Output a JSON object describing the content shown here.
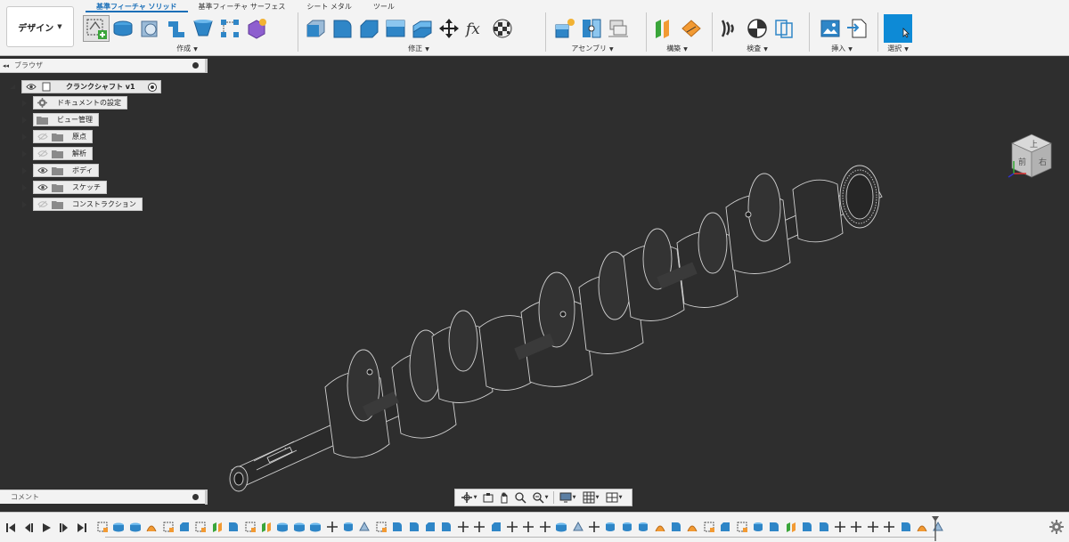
{
  "workspace": {
    "label": "デザイン"
  },
  "tabs": [
    {
      "label": "基準フィーチャ ソリッド",
      "active": true
    },
    {
      "label": "基準フィーチャ サーフェス",
      "active": false
    },
    {
      "label": "シート メタル",
      "active": false
    },
    {
      "label": "ツール",
      "active": false
    }
  ],
  "groups": {
    "create": "作成",
    "modify": "修正",
    "assemble": "アセンブリ",
    "construct": "構築",
    "inspect": "検査",
    "insert": "挿入",
    "select": "選択"
  },
  "browser": {
    "title": "ブラウザ",
    "root": "クランクシャフト v1",
    "items": [
      {
        "label": "ドキュメントの設定",
        "icon": "gear-icon",
        "visible": null
      },
      {
        "label": "ビュー管理",
        "icon": "folder-icon",
        "visible": null
      },
      {
        "label": "原点",
        "icon": "folder-icon",
        "visible": false
      },
      {
        "label": "解析",
        "icon": "folder-icon",
        "visible": false
      },
      {
        "label": "ボディ",
        "icon": "folder-icon",
        "visible": true
      },
      {
        "label": "スケッチ",
        "icon": "folder-icon",
        "visible": true
      },
      {
        "label": "コンストラクション",
        "icon": "folder-icon",
        "visible": false
      }
    ]
  },
  "viewcube": {
    "top_label": "上",
    "front_label": "前",
    "right_label": "右"
  },
  "comments": {
    "label": "コメント"
  },
  "colors": {
    "accent": "#1a6fb8",
    "select_tool": "#0d8ad6",
    "viewport_bg": "#2e2e2e",
    "edge": "#cfcfcf"
  }
}
